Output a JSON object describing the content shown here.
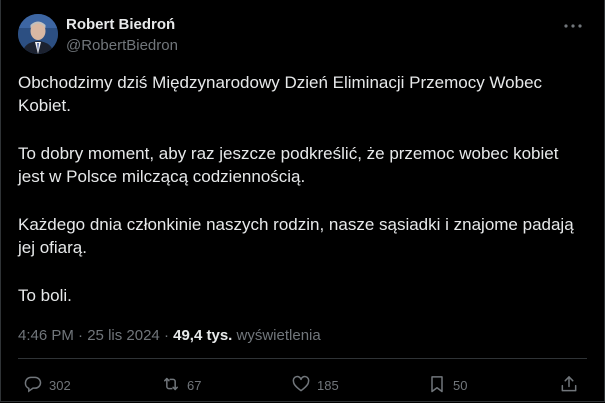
{
  "author": {
    "display_name": "Robert Biedroń",
    "handle": "@RobertBiedron"
  },
  "post": {
    "paragraphs": [
      "Obchodzimy dziś Międzynarodowy Dzień Eliminacji Przemocy Wobec Kobiet.",
      "To dobry moment, aby raz jeszcze podkreślić, że przemoc wobec kobiet jest w Polsce milczącą codziennością.",
      "Każdego dnia członkinie naszych rodzin, nasze sąsiadki i znajome padają jej ofiarą.",
      "To boli."
    ]
  },
  "meta": {
    "time": "4:46 PM",
    "separator": " · ",
    "date": "25 lis 2024",
    "separator2": " · ",
    "views_count": "49,4 tys.",
    "views_label": " wyświetlenia"
  },
  "actions": {
    "reply": {
      "icon": "reply-icon",
      "count": "302"
    },
    "repost": {
      "icon": "repost-icon",
      "count": "67"
    },
    "like": {
      "icon": "heart-icon",
      "count": "185"
    },
    "bookmark": {
      "icon": "bookmark-icon",
      "count": "50"
    },
    "share": {
      "icon": "share-icon"
    }
  },
  "colors": {
    "background": "#000000",
    "text_primary": "#e7e9ea",
    "text_secondary": "#71767b",
    "border": "#2f3336"
  }
}
